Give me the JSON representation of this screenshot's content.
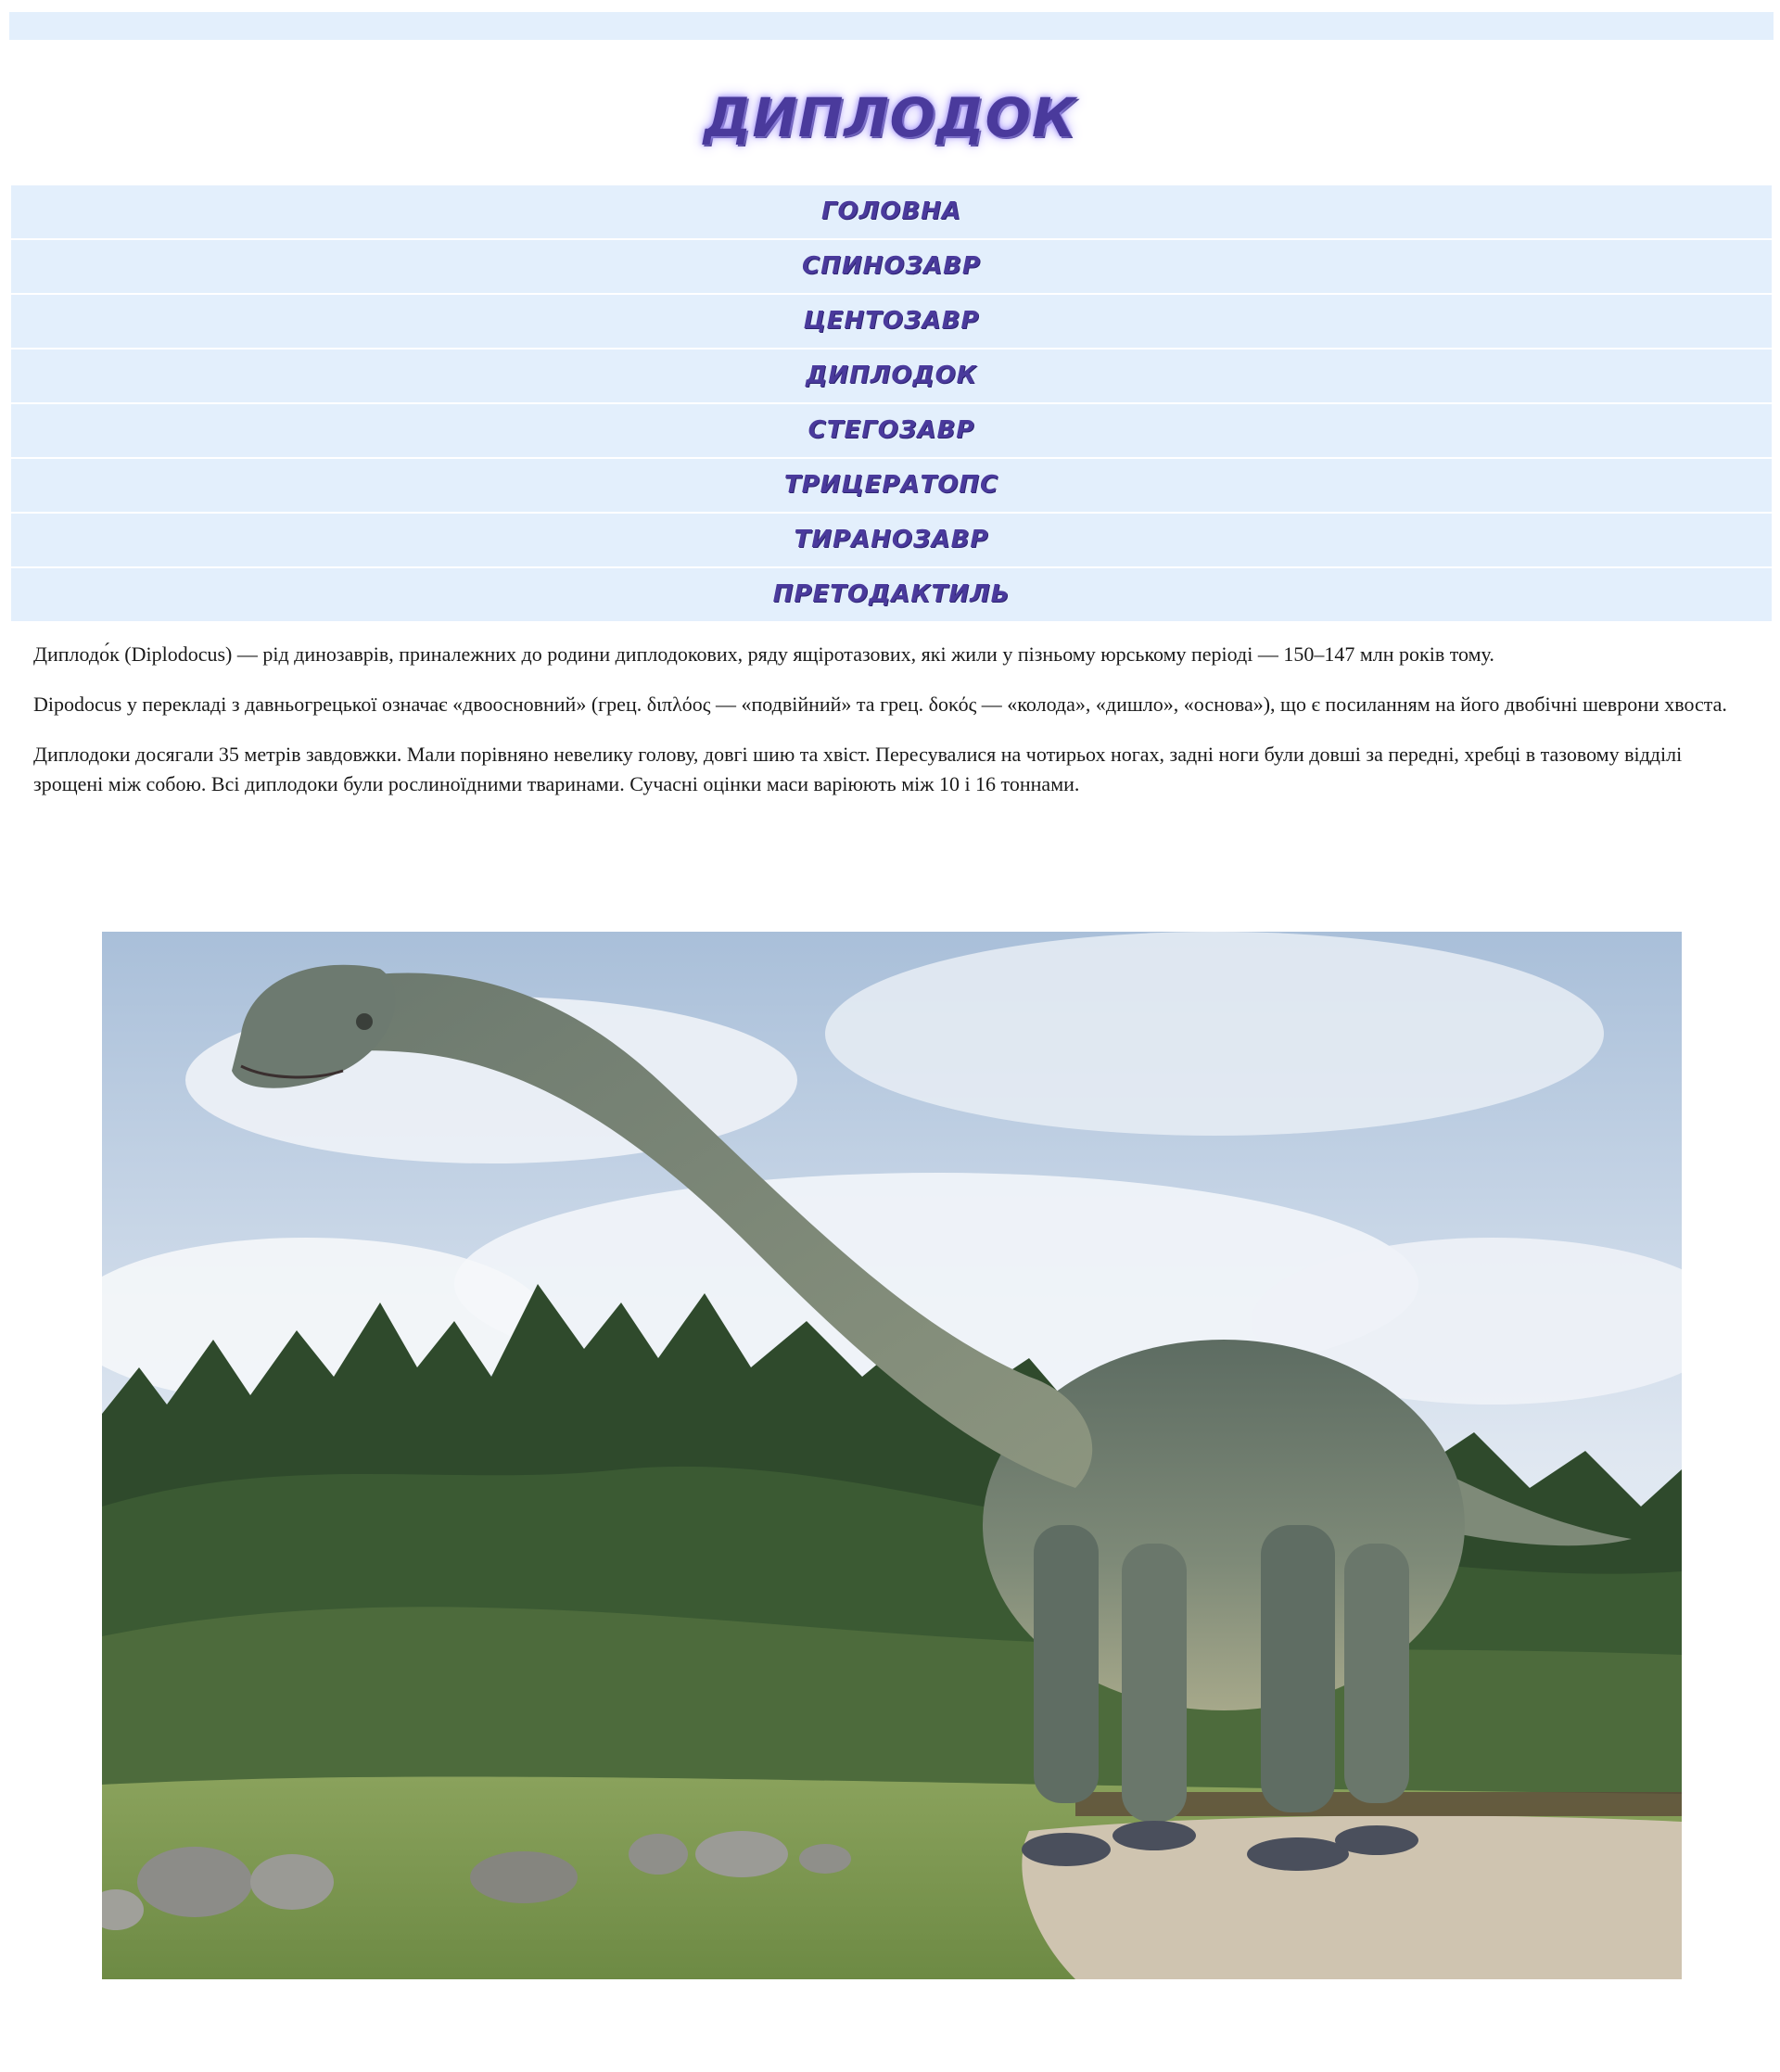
{
  "header": {
    "title": "ДИПЛОДОК"
  },
  "nav": {
    "items": [
      {
        "label": "ГОЛОВНА"
      },
      {
        "label": "СПИНОЗАВР"
      },
      {
        "label": "ЦЕНТОЗАВР"
      },
      {
        "label": "ДИПЛОДОК"
      },
      {
        "label": "СТЕГОЗАВР"
      },
      {
        "label": "ТРИЦЕРАТОПС"
      },
      {
        "label": "ТИРАНОЗАВР"
      },
      {
        "label": "ПРЕТОДАКТИЛЬ"
      }
    ]
  },
  "article": {
    "paragraphs": [
      "Диплодо́к (Diplodocus) — рід динозаврів, приналежних до родини диплодокових, ряду ящіротазових, які жили у пізньому юрському періоді — 150–147 млн років тому.",
      "Dipodocus у перекладі з давньогрецької означає «двоосновний» (грец. διπλόος — «подвійний» та грец. δοκός — «колода», «дишло», «основа»), що є посиланням на його двобічні шеврони хвоста.",
      "Диплодоки досягали 35 метрів завдовжки. Мали порівняно невелику голову, довгі шию та хвіст. Пересувалися на чотирьох ногах, задні ноги були довші за передні, хребці в тазовому відділі зрощені між собою. Всі диплодоки були рослиноїдними тваринами. Сучасні оцінки маси варіюють між 10 і 16 тоннами."
    ]
  },
  "colors": {
    "nav_background": "#e3effc",
    "title_color": "#4a3a9c",
    "text_color": "#1a1a1a"
  }
}
